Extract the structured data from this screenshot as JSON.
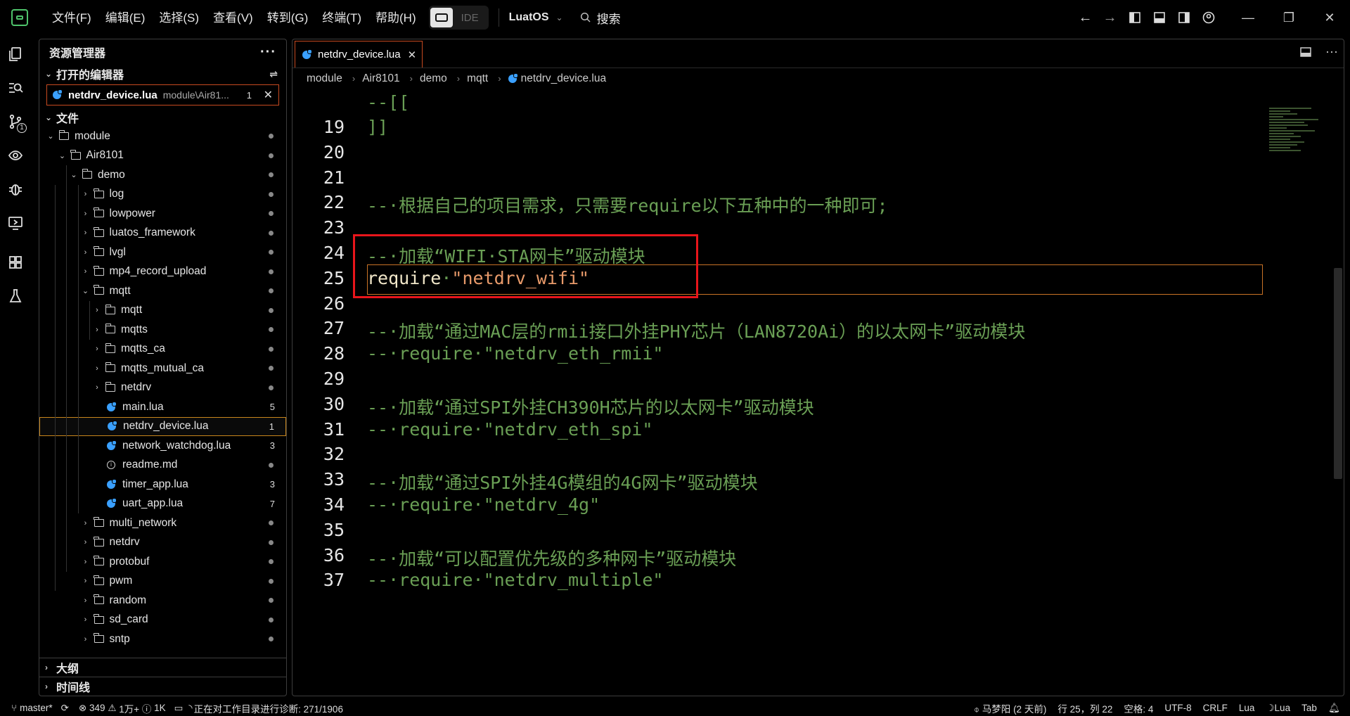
{
  "menu": [
    "文件(F)",
    "编辑(E)",
    "选择(S)",
    "查看(V)",
    "转到(G)",
    "终端(T)",
    "帮助(H)"
  ],
  "ide_label": "IDE",
  "product": "LuatOS",
  "search_label": "搜索",
  "sidebar": {
    "title": "资源管理器",
    "open_editors_label": "打开的编辑器",
    "open_editor": {
      "name": "netdrv_device.lua",
      "path": "module\\Air81...",
      "problems": "1"
    },
    "files_label": "文件",
    "tree": [
      {
        "label": "module",
        "depth": 0,
        "type": "folder",
        "open": true
      },
      {
        "label": "Air8101",
        "depth": 1,
        "type": "folder",
        "open": true
      },
      {
        "label": "demo",
        "depth": 2,
        "type": "folder",
        "open": true
      },
      {
        "label": "log",
        "depth": 3,
        "type": "folder"
      },
      {
        "label": "lowpower",
        "depth": 3,
        "type": "folder"
      },
      {
        "label": "luatos_framework",
        "depth": 3,
        "type": "folder"
      },
      {
        "label": "lvgl",
        "depth": 3,
        "type": "folder"
      },
      {
        "label": "mp4_record_upload",
        "depth": 3,
        "type": "folder"
      },
      {
        "label": "mqtt",
        "depth": 3,
        "type": "folder",
        "open": true
      },
      {
        "label": "mqtt",
        "depth": 4,
        "type": "folder"
      },
      {
        "label": "mqtts",
        "depth": 4,
        "type": "folder"
      },
      {
        "label": "mqtts_ca",
        "depth": 4,
        "type": "folder"
      },
      {
        "label": "mqtts_mutual_ca",
        "depth": 4,
        "type": "folder"
      },
      {
        "label": "netdrv",
        "depth": 4,
        "type": "folder"
      },
      {
        "label": "main.lua",
        "depth": 4,
        "type": "lua",
        "count": "5"
      },
      {
        "label": "netdrv_device.lua",
        "depth": 4,
        "type": "lua",
        "count": "1",
        "selected": true
      },
      {
        "label": "network_watchdog.lua",
        "depth": 4,
        "type": "lua",
        "count": "3"
      },
      {
        "label": "readme.md",
        "depth": 4,
        "type": "info"
      },
      {
        "label": "timer_app.lua",
        "depth": 4,
        "type": "lua",
        "count": "3"
      },
      {
        "label": "uart_app.lua",
        "depth": 4,
        "type": "lua",
        "count": "7"
      },
      {
        "label": "multi_network",
        "depth": 3,
        "type": "folder"
      },
      {
        "label": "netdrv",
        "depth": 3,
        "type": "folder"
      },
      {
        "label": "protobuf",
        "depth": 3,
        "type": "folder"
      },
      {
        "label": "pwm",
        "depth": 3,
        "type": "folder"
      },
      {
        "label": "random",
        "depth": 3,
        "type": "folder"
      },
      {
        "label": "sd_card",
        "depth": 3,
        "type": "folder"
      },
      {
        "label": "sntp",
        "depth": 3,
        "type": "folder"
      }
    ],
    "outline_label": "大纲",
    "timeline_label": "时间线"
  },
  "editor": {
    "tab": "netdrv_device.lua",
    "breadcrumb": [
      "module",
      "Air8101",
      "demo",
      "mqtt",
      "netdrv_device.lua"
    ],
    "lines": [
      {
        "n": "19",
        "parts": [
          {
            "c": "cm",
            "t": "]]"
          }
        ]
      },
      {
        "n": "20",
        "parts": []
      },
      {
        "n": "21",
        "parts": []
      },
      {
        "n": "22",
        "parts": [
          {
            "c": "cm",
            "t": "--·根据自己的项目需求，只需要require以下五种中的一种即可;"
          }
        ]
      },
      {
        "n": "23",
        "parts": []
      },
      {
        "n": "24",
        "parts": [
          {
            "c": "cm",
            "t": "--·加载“WIFI·STA网卡”驱动模块"
          }
        ]
      },
      {
        "n": "25",
        "parts": [
          {
            "c": "kw",
            "t": "require"
          },
          {
            "c": "cm",
            "t": "·"
          },
          {
            "c": "st",
            "t": "\"netdrv_wifi\""
          }
        ]
      },
      {
        "n": "26",
        "parts": []
      },
      {
        "n": "27",
        "parts": [
          {
            "c": "cm",
            "t": "--·加载“通过MAC层的rmii接口外挂PHY芯片（LAN8720Ai）的以太网卡”驱动模块"
          }
        ]
      },
      {
        "n": "28",
        "parts": [
          {
            "c": "cm",
            "t": "--·require·\"netdrv_eth_rmii\""
          }
        ]
      },
      {
        "n": "29",
        "parts": []
      },
      {
        "n": "30",
        "parts": [
          {
            "c": "cm",
            "t": "--·加载“通过SPI外挂CH390H芯片的以太网卡”驱动模块"
          }
        ]
      },
      {
        "n": "31",
        "parts": [
          {
            "c": "cm",
            "t": "--·require·\"netdrv_eth_spi\""
          }
        ]
      },
      {
        "n": "32",
        "parts": []
      },
      {
        "n": "33",
        "parts": [
          {
            "c": "cm",
            "t": "--·加载“通过SPI外挂4G模组的4G网卡”驱动模块"
          }
        ]
      },
      {
        "n": "34",
        "parts": [
          {
            "c": "cm",
            "t": "--·require·\"netdrv_4g\""
          }
        ]
      },
      {
        "n": "35",
        "parts": []
      },
      {
        "n": "36",
        "parts": [
          {
            "c": "cm",
            "t": "--·加载“可以配置优先级的多种网卡”驱动模块"
          }
        ]
      },
      {
        "n": "37",
        "parts": [
          {
            "c": "cm",
            "t": "--·require·\"netdrv_multiple\""
          }
        ]
      }
    ]
  },
  "status": {
    "branch": "master*",
    "errors": "349",
    "warnings": "1万+",
    "infos": "1K",
    "diagnostics": "正在对工作目录进行诊断: 271/1906",
    "author": "马梦阳 (2 天前)",
    "position": "行 25，列 22",
    "spaces": "空格: 4",
    "encoding": "UTF-8",
    "eol": "CRLF",
    "language": "Lua",
    "lua_server": "Lua",
    "tab_mode": "Tab"
  },
  "colors": {
    "comment": "#6a9f55",
    "string": "#e89a6a",
    "highlight_box": "#e8151b",
    "accent": "#c74a20"
  }
}
